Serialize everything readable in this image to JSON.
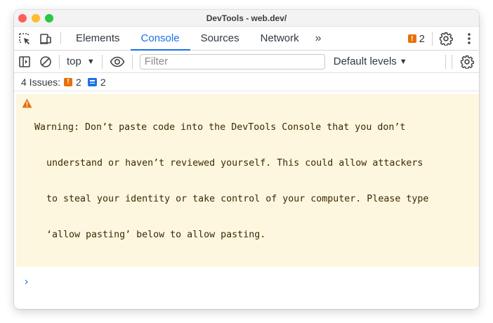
{
  "window": {
    "title": "DevTools - web.dev/"
  },
  "tabs": [
    {
      "label": "Elements"
    },
    {
      "label": "Console"
    },
    {
      "label": "Sources"
    },
    {
      "label": "Network"
    }
  ],
  "tabbar": {
    "more_tabs": "»",
    "issues_count": "2"
  },
  "toolbar": {
    "context": "top",
    "filter_placeholder": "Filter",
    "filter_value": "",
    "levels": "Default levels"
  },
  "issues": {
    "label": "4 Issues:",
    "warning_count": "2",
    "info_count": "2"
  },
  "warning": {
    "lines": [
      "Warning: Don’t paste code into the DevTools Console that you don’t",
      "understand or haven’t reviewed yourself. This could allow attackers",
      "to steal your identity or take control of your computer. Please type",
      "‘allow pasting’ below to allow pasting."
    ]
  },
  "console": {
    "prompt": "›"
  },
  "colors": {
    "accent": "#1a73e8",
    "warning_bg": "#fef7e0",
    "warning_icon": "#e8710a",
    "issue_badge": "#e8710a"
  },
  "icons": {
    "inspect": "element-picker-icon",
    "device": "device-toolbar-icon",
    "sidebar": "sidebar-toggle-icon",
    "clear": "clear-console-icon",
    "eye": "live-expression-icon",
    "settings": "gear-icon",
    "menu": "more-vertical-icon",
    "warning": "warning-triangle-icon"
  }
}
